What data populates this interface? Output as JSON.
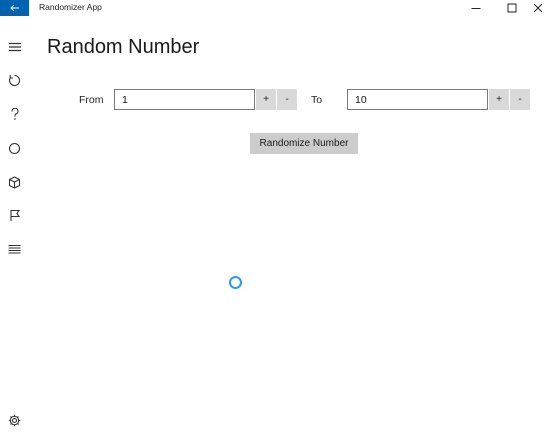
{
  "window": {
    "title": "Randomizer App"
  },
  "page": {
    "title": "Random Number"
  },
  "range": {
    "from_label": "From",
    "from_value": "1",
    "to_label": "To",
    "to_value": "10",
    "increment_label": "+",
    "decrement_label": "-"
  },
  "actions": {
    "randomize_label": "Randomize Number"
  },
  "nav": {
    "items": [
      {
        "icon": "hamburger-menu-icon"
      },
      {
        "icon": "refresh-icon"
      },
      {
        "icon": "question-icon"
      },
      {
        "icon": "circle-icon"
      },
      {
        "icon": "cube-icon"
      },
      {
        "icon": "flag-icon"
      },
      {
        "icon": "list-icon"
      }
    ],
    "footer_icon": "gear-icon"
  },
  "colors": {
    "accent": "#0063b1",
    "spinner": "#2f9ae6",
    "button_bg": "#cccccc",
    "stepper_bg": "#d9d9d9"
  }
}
